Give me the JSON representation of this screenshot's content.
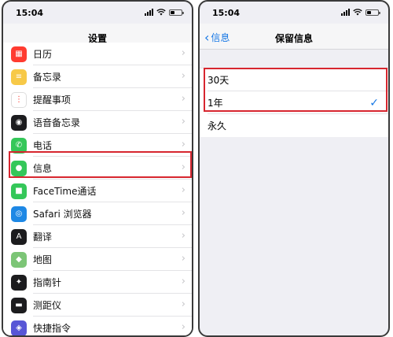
{
  "left": {
    "status": {
      "time": "15:04"
    },
    "nav": {
      "title": "设置"
    },
    "items": [
      {
        "label": "日历",
        "icon": "calendar-icon",
        "color": "#ff3b30"
      },
      {
        "label": "备忘录",
        "icon": "notes-icon",
        "color": "#f7c948"
      },
      {
        "label": "提醒事项",
        "icon": "reminders-icon",
        "color": "#ffffff"
      },
      {
        "label": "语音备忘录",
        "icon": "voice-memo-icon",
        "color": "#1c1c1e"
      },
      {
        "label": "电话",
        "icon": "phone-icon",
        "color": "#34c759"
      },
      {
        "label": "信息",
        "icon": "messages-icon",
        "color": "#34c759"
      },
      {
        "label": "FaceTime通话",
        "icon": "facetime-icon",
        "color": "#34c759"
      },
      {
        "label": "Safari 浏览器",
        "icon": "safari-icon",
        "color": "#1e88e5"
      },
      {
        "label": "翻译",
        "icon": "translate-icon",
        "color": "#1c1c1e"
      },
      {
        "label": "地图",
        "icon": "maps-icon",
        "color": "#7cc576"
      },
      {
        "label": "指南针",
        "icon": "compass-icon",
        "color": "#1c1c1e"
      },
      {
        "label": "测距仪",
        "icon": "measure-icon",
        "color": "#1c1c1e"
      },
      {
        "label": "快捷指令",
        "icon": "shortcuts-icon",
        "color": "#5856d6"
      }
    ]
  },
  "right": {
    "status": {
      "time": "15:04"
    },
    "nav": {
      "back_label": "信息",
      "title": "保留信息"
    },
    "options": [
      {
        "label": "30天",
        "selected": false
      },
      {
        "label": "1年",
        "selected": true
      },
      {
        "label": "永久",
        "selected": false
      }
    ]
  },
  "colors": {
    "accent": "#1677e5",
    "highlight": "#d7262f"
  }
}
